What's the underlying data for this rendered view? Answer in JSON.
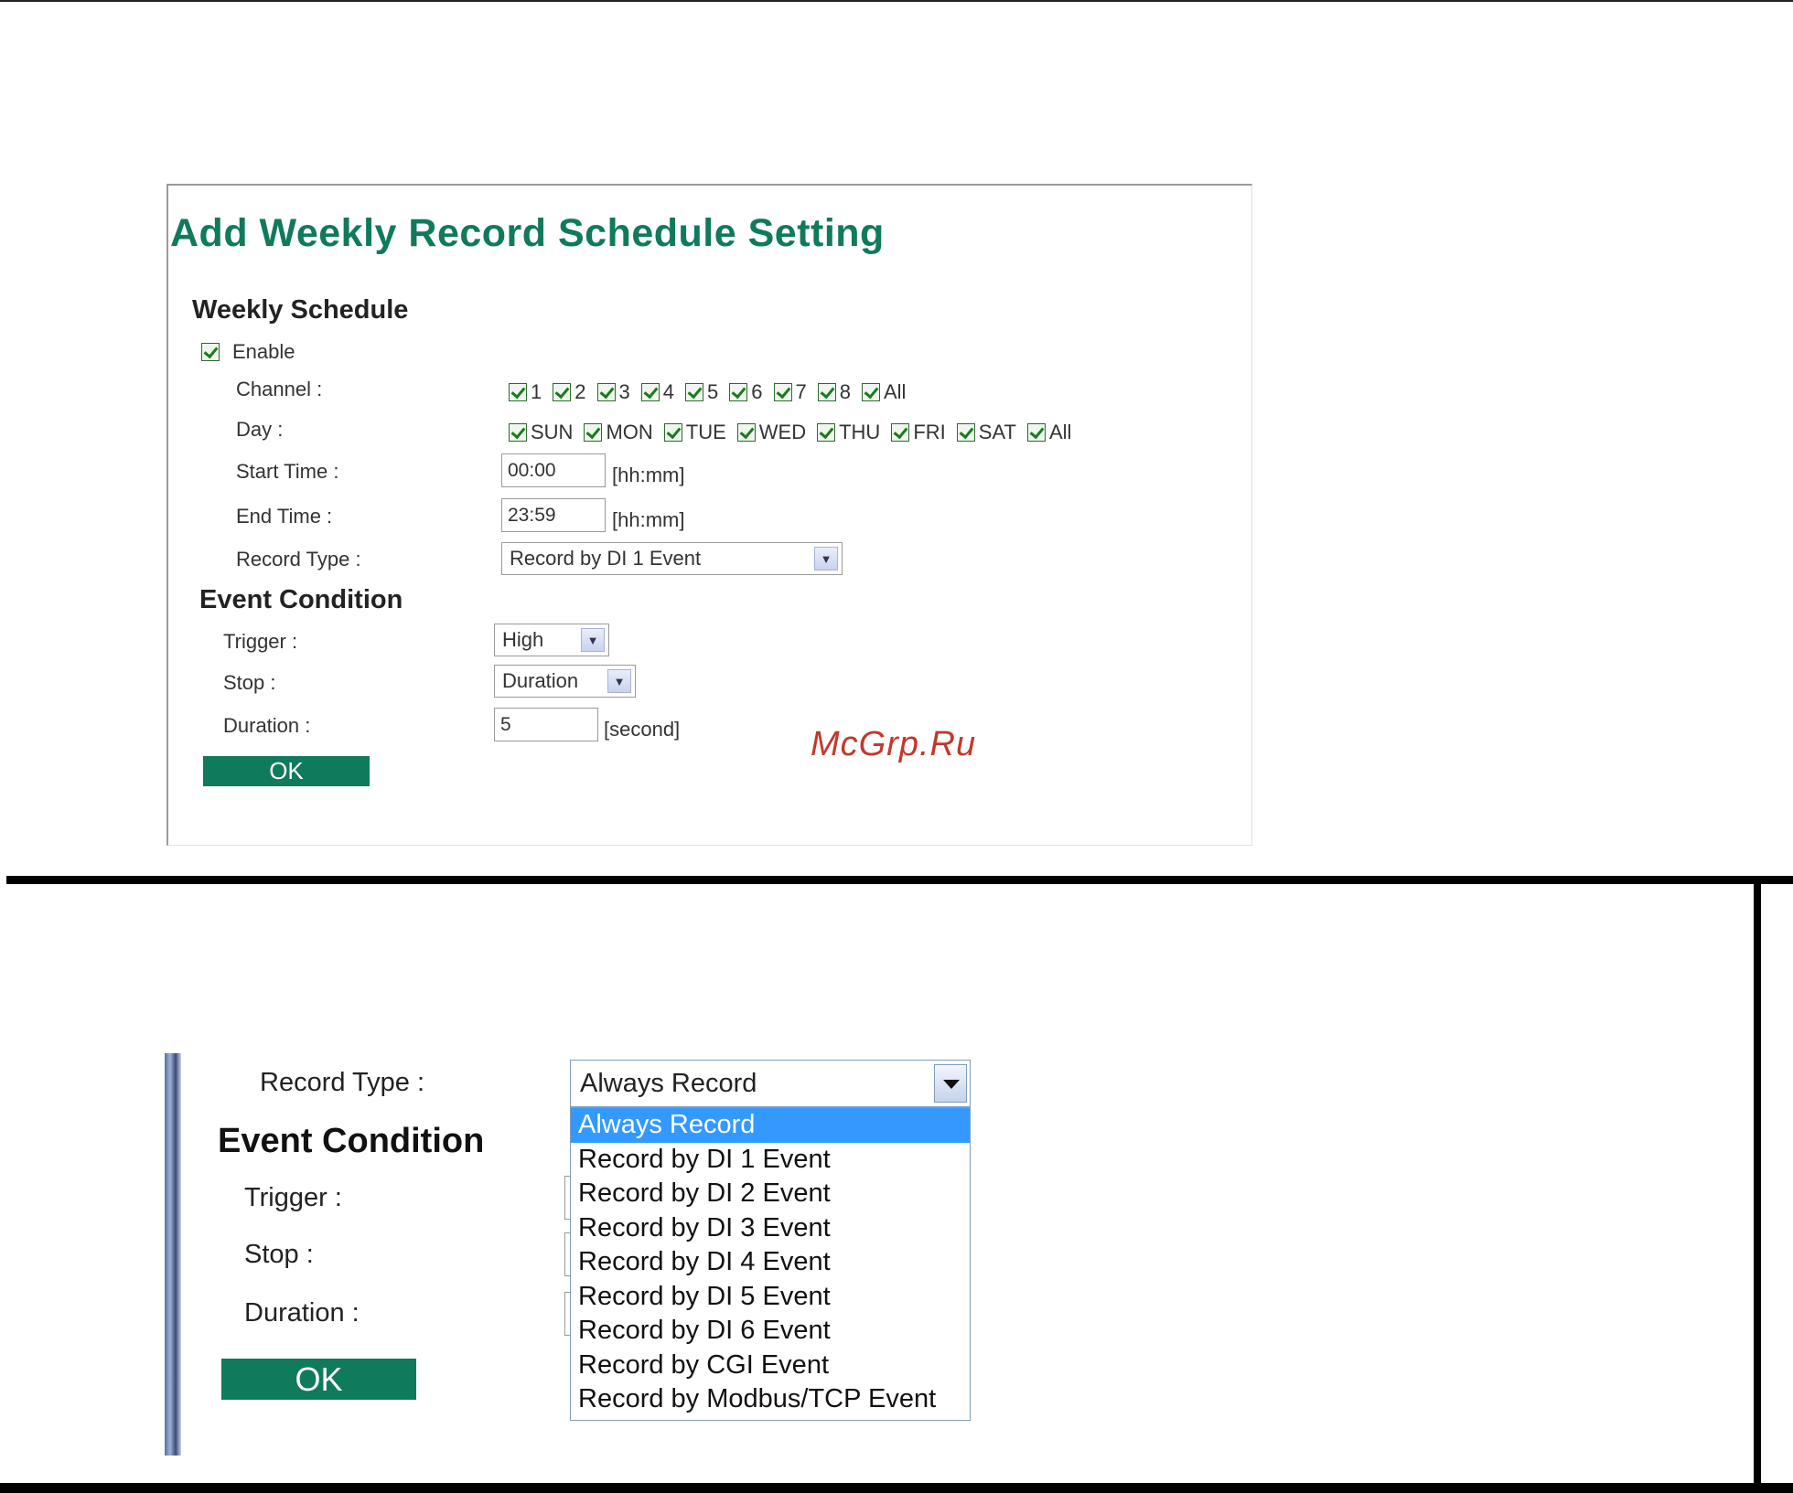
{
  "page_title": "Add Weekly Record Schedule Setting",
  "weekly_schedule": {
    "heading": "Weekly Schedule",
    "enable_label": "Enable",
    "enable_checked": true,
    "channel_label": "Channel :",
    "channels": [
      "1",
      "2",
      "3",
      "4",
      "5",
      "6",
      "7",
      "8",
      "All"
    ],
    "day_label": "Day :",
    "days": [
      "SUN",
      "MON",
      "TUE",
      "WED",
      "THU",
      "FRI",
      "SAT",
      "All"
    ],
    "start_time_label": "Start Time :",
    "start_time_value": "00:00",
    "start_time_unit": "[hh:mm]",
    "end_time_label": "End Time :",
    "end_time_value": "23:59",
    "end_time_unit": "[hh:mm]",
    "record_type_label": "Record Type :",
    "record_type_value": "Record by DI 1 Event"
  },
  "event_condition": {
    "heading": "Event Condition",
    "trigger_label": "Trigger :",
    "trigger_value": "High",
    "stop_label": "Stop :",
    "stop_value": "Duration",
    "duration_label": "Duration :",
    "duration_value": "5",
    "duration_unit": "[second]",
    "ok_label": "OK"
  },
  "watermark": "McGrp.Ru",
  "dropdown_view": {
    "record_type_label": "Record Type :",
    "selected": "Always Record",
    "event_heading": "Event Condition",
    "trigger_label": "Trigger :",
    "stop_label": "Stop :",
    "duration_label": "Duration :",
    "ok_label": "OK",
    "options": [
      "Always Record",
      "Record by DI 1 Event",
      "Record by DI 2 Event",
      "Record by DI 3 Event",
      "Record by DI 4 Event",
      "Record by DI 5 Event",
      "Record by DI 6 Event",
      "Record by CGI Event",
      "Record by Modbus/TCP Event"
    ],
    "highlighted_index": 0
  }
}
